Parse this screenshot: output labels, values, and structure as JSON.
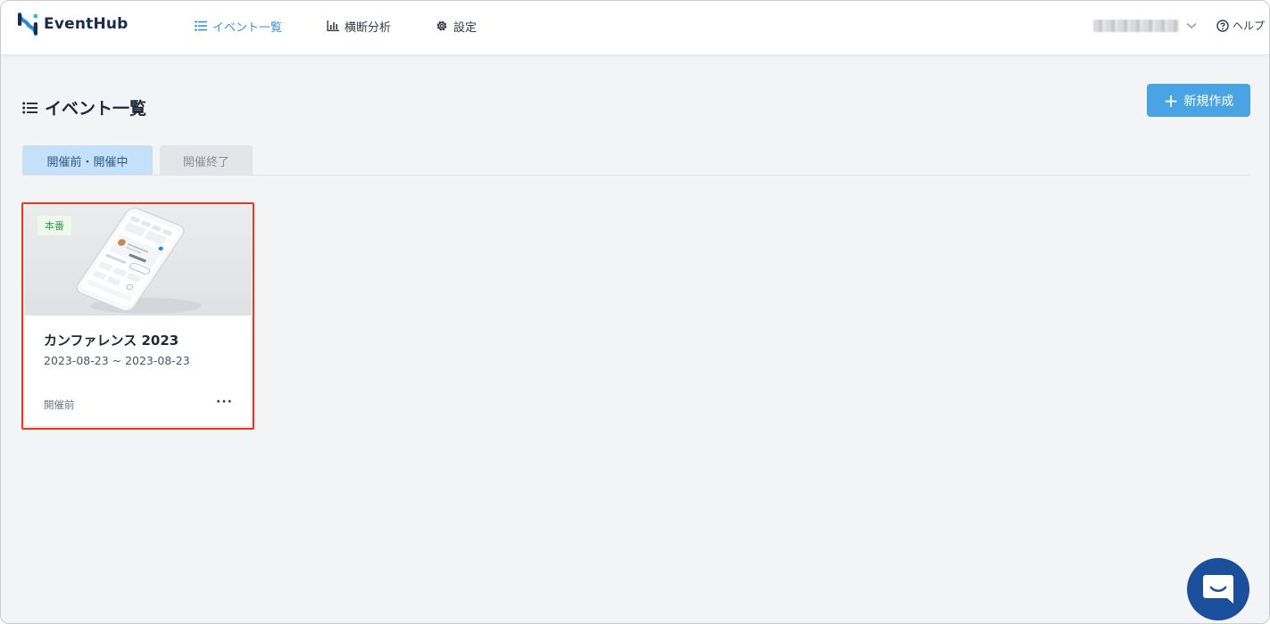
{
  "app": {
    "logo_text": "EventHub",
    "brand_color": "#3b8ed8",
    "accent_button": "#4aa3e3"
  },
  "nav": {
    "items": [
      {
        "label": "イベント一覧",
        "icon": "list-icon",
        "active": true
      },
      {
        "label": "横断分析",
        "icon": "bar-chart-icon",
        "active": false
      },
      {
        "label": "設定",
        "icon": "gear-icon",
        "active": false
      }
    ]
  },
  "header": {
    "help_label": "ヘルプ"
  },
  "page": {
    "title": "イベント一覧",
    "new_button_label": "新規作成"
  },
  "tabs": [
    {
      "label": "開催前・開催中",
      "active": true
    },
    {
      "label": "開催終了",
      "active": false
    }
  ],
  "events": [
    {
      "badge": "本番",
      "title": "カンファレンス 2023",
      "date_range": "2023-08-23 ~ 2023-08-23",
      "status": "開催前",
      "more_label": "···"
    }
  ]
}
